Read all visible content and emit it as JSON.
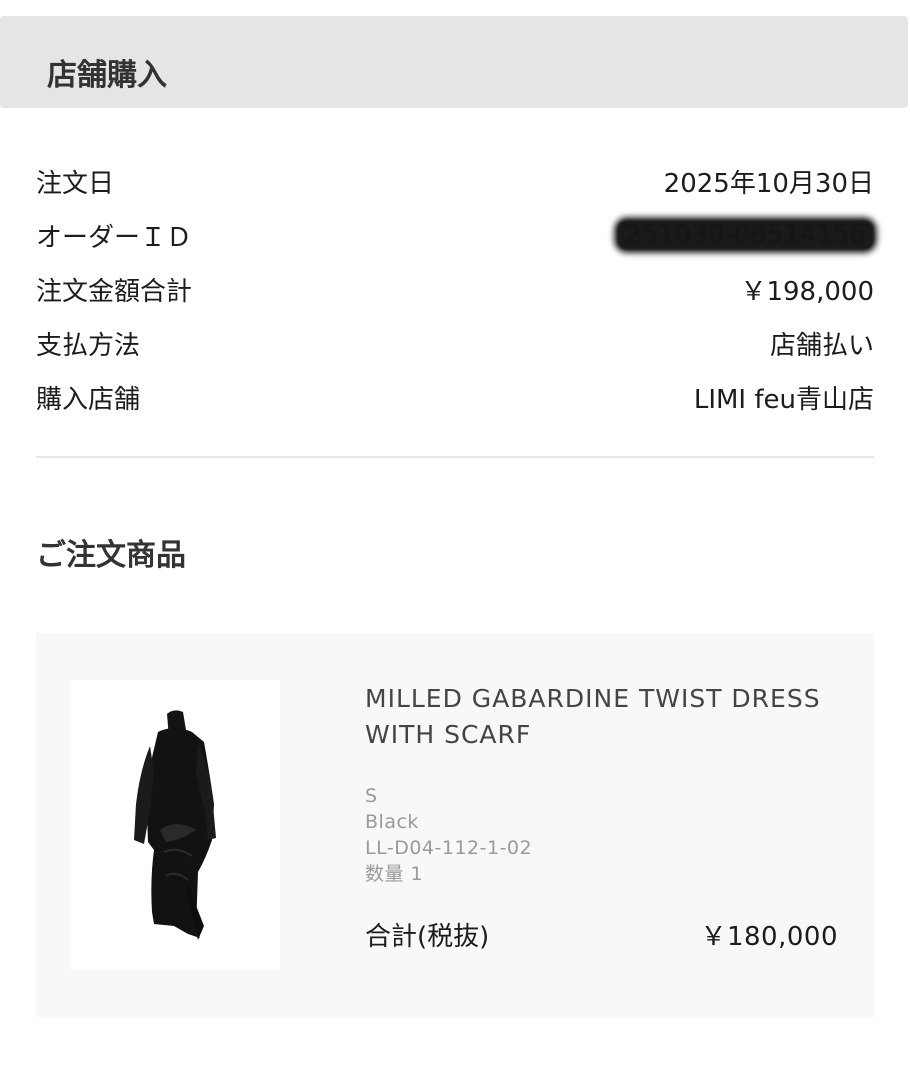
{
  "header": {
    "title": "店舗購入"
  },
  "order_info": [
    {
      "label": "注文日",
      "value": "2025年10月30日"
    },
    {
      "label": "オーダーＩＤ",
      "value": "251030-06514156"
    },
    {
      "label": "注文金額合計",
      "value": "￥198,000"
    },
    {
      "label": "支払方法",
      "value": "店舗払い"
    },
    {
      "label": "購入店舗",
      "value": "LIMI feu青山店"
    }
  ],
  "items_section": {
    "title": "ご注文商品"
  },
  "product": {
    "image_icon": "black-dress-product-image",
    "name": "MILLED GABARDINE TWIST DRESS WITH SCARF",
    "size": "S",
    "color": "Black",
    "sku": "LL-D04-112-1-02",
    "quantity": "数量 1",
    "subtotal_label": "合計(税抜)",
    "subtotal_value": "￥180,000"
  }
}
